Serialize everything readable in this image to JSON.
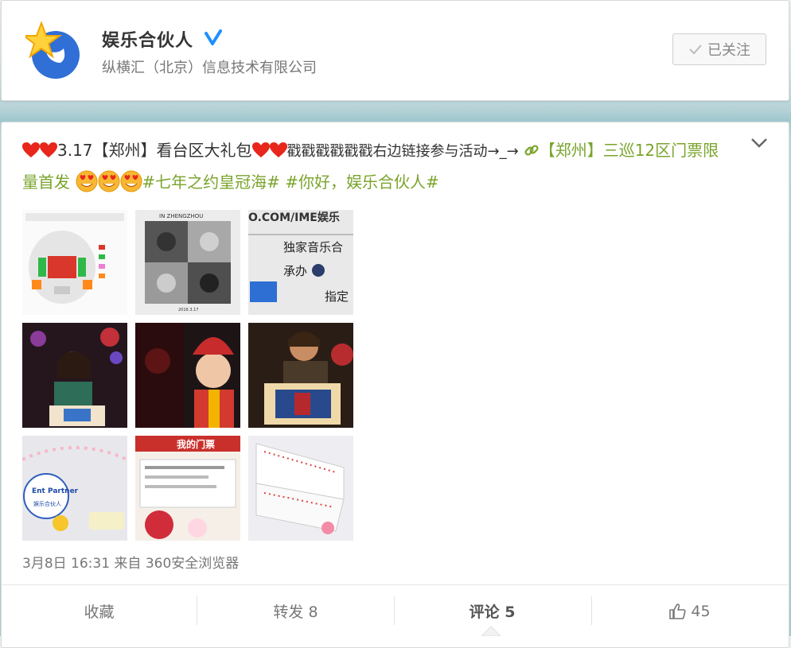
{
  "profile": {
    "name": "娱乐合伙人",
    "company": "纵横汇（北京）信息技术有限公司",
    "follow_label": "已关注"
  },
  "post": {
    "text_1": "3.17【郑州】看台区大礼包",
    "text_2": "戳戳戳戳戳戳右边链接参与活动→_→",
    "link_text": "【郑州】三巡12区门票限量首发",
    "topic_1": "#七年之约皇冠海#",
    "topic_2": "#你好，娱乐合伙人#",
    "meta": "3月8日 16:31 来自 360安全浏览器",
    "thumb_texts": {
      "t2_caption": "IN ZHENGZHOU",
      "t2_date": "2016.3.17",
      "t3_line1": "O.COM/IME娱乐",
      "t3_line2": "独家音乐合",
      "t3_line3": "承办",
      "t3_line4": "指定",
      "t7_logo": "Ent Partner",
      "t7_sub": "娱乐合伙人",
      "t8_title": "我的门票"
    }
  },
  "actions": {
    "favorite": "收藏",
    "repost": "转发 8",
    "comment": "评论 5",
    "like_count": "45"
  },
  "colors": {
    "topic": "#7aa42c",
    "verified": "#1e90ff",
    "heart": "#e8261b"
  }
}
